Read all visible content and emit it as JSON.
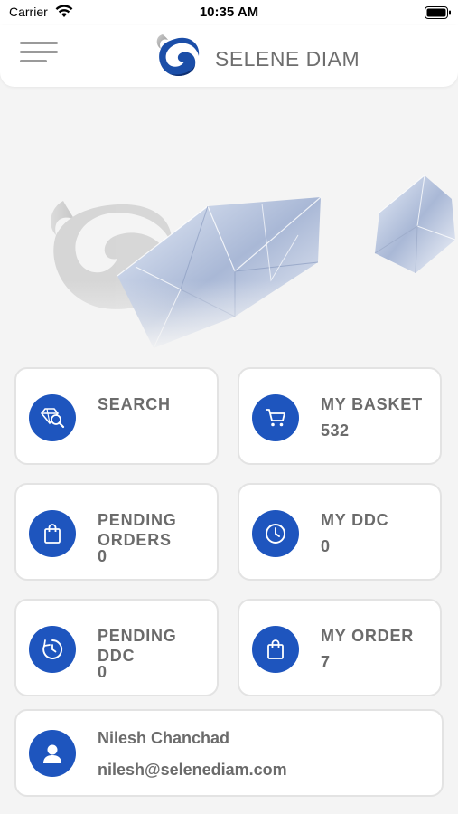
{
  "status_bar": {
    "carrier": "Carrier",
    "time": "10:35 AM"
  },
  "header": {
    "brand_name": "SELENE DIAM",
    "menu_icon": "hamburger-menu-icon",
    "logo_icon": "selene-swan-logo"
  },
  "tiles": [
    {
      "label": "SEARCH",
      "value": "",
      "icon": "diamond-search-icon"
    },
    {
      "label": "MY BASKET",
      "value": "532",
      "icon": "cart-icon"
    },
    {
      "label": "PENDING\nORDERS",
      "value": "0",
      "icon": "shopping-bag-icon"
    },
    {
      "label": "MY DDC",
      "value": "0",
      "icon": "clock-icon"
    },
    {
      "label": "PENDING\nDDC",
      "value": "0",
      "icon": "timer-icon"
    },
    {
      "label": "MY ORDER",
      "value": "7",
      "icon": "shopping-bag-icon"
    }
  ],
  "user": {
    "name": "Nilesh Chanchad",
    "email": "nilesh@selenediam.com",
    "icon": "user-icon"
  },
  "colors": {
    "accent": "#1e55be",
    "background": "#f4f4f4",
    "card": "#ffffff",
    "text": "#6b6b6b"
  }
}
